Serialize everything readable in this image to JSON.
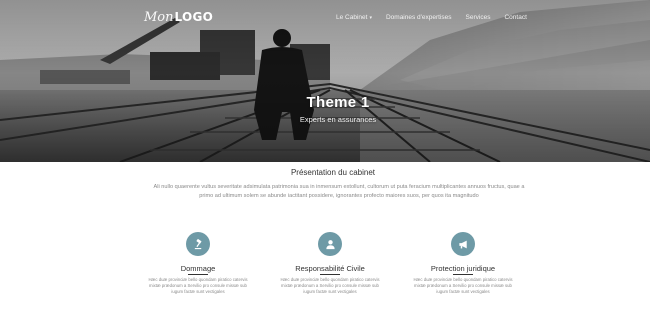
{
  "header": {
    "logo_script": "Mon",
    "logo_word": "LOGO",
    "nav": [
      {
        "label": "Le Cabinet",
        "has_dropdown": true,
        "caret": "▾"
      },
      {
        "label": "Domaines d'expertises"
      },
      {
        "label": "Services"
      },
      {
        "label": "Contact"
      }
    ]
  },
  "hero": {
    "title": "Theme 1",
    "subtitle": "Experts en assurances"
  },
  "presentation": {
    "title": "Présentation du cabinet",
    "text": "Ali nullo quaerente vultus severitate adsimulata patrimonia sua in inmensum extollunt, cultorum ut puta feracium multiplicantes annuos fructus, quae a primo ad ultimum solem se abunde iactitant possidere, ignorantes profecto maiores suos, per quos ita magnitudo"
  },
  "features": [
    {
      "icon": "gavel-icon",
      "title": "Dommage",
      "text": "Hæc duæ provinciæ bello quondam piratico catervis mixtæ prædonum a Servilio pro consule missæ sub iugum factæ sunt vectigales"
    },
    {
      "icon": "user-icon",
      "title": "Responsabilité Civile",
      "text": "Hæc duæ provinciæ bello quondam piratico catervis mixtæ prædonum a Servilio pro consule missæ sub iugum factæ sunt vectigales"
    },
    {
      "icon": "megaphone-icon",
      "title": "Protection juridique",
      "text": "Hæc duæ provinciæ bello quondam piratico catervis mixtæ prædonum a Servilio pro consule missæ sub iugum factæ sunt vectigales"
    }
  ],
  "colors": {
    "accent": "#6e9aa6",
    "hero_bg": "#6e6e6e",
    "text_muted": "#8a8a8a"
  }
}
